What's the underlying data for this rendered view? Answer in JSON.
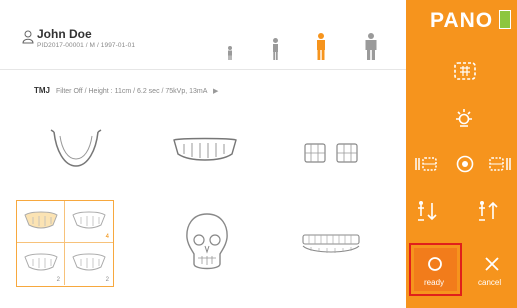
{
  "patient": {
    "name": "John Doe",
    "id_line": "PID2017-00001 / M / 1997-01-01"
  },
  "exam": {
    "mode": "TMJ",
    "params": "Filter Off / Height : 11cm / 6.2 sec / 75kVp, 13mA"
  },
  "program_grid": {
    "multi_tmj_counts": [
      "4",
      "2",
      "2"
    ]
  },
  "sidebar": {
    "title": "PANO",
    "ready_label": "ready",
    "cancel_label": "cancel"
  },
  "colors": {
    "accent": "#f6941d",
    "highlight": "#e0201b",
    "battery": "#8dc63f",
    "selected_age": "#f6941d",
    "icon_gray": "#9a9a9a"
  },
  "icons": {
    "patient": "patient-icon",
    "age": [
      "child-small-icon",
      "child-icon",
      "adult-icon",
      "adult-large-icon"
    ],
    "sidebar": [
      "pano-view-icon",
      "light-icon",
      "arch-narrow-icon",
      "arch-center-icon",
      "arch-wide-icon",
      "move-down-icon",
      "move-up-icon",
      "ready-icon",
      "cancel-icon"
    ]
  }
}
